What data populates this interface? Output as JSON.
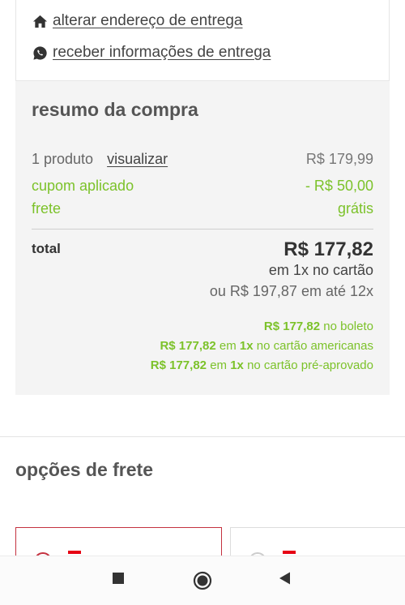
{
  "delivery_links": {
    "change_address": "alterar endereço de entrega",
    "receive_info": "receber informações de entrega"
  },
  "summary": {
    "title": "resumo da compra",
    "products_label": "1 produto",
    "view_link": "visualizar",
    "products_value": "R$ 179,99",
    "coupon_label": "cupom aplicado",
    "coupon_value": "- R$ 50,00",
    "shipping_label": "frete",
    "shipping_value": "grátis",
    "total_label": "total",
    "total_value": "R$ 177,82",
    "total_installment": "em 1x no cartão",
    "alt_installment": "ou R$ 197,87 em até 12x",
    "options": {
      "boleto_value": "R$ 177,82",
      "boleto_text": "no boleto",
      "americanas_value": "R$ 177,82",
      "americanas_mid": "em",
      "americanas_x": "1x",
      "americanas_text": "no cartão americanas",
      "preapproved_value": "R$ 177,82",
      "preapproved_mid": "em",
      "preapproved_x": "1x",
      "preapproved_text": "no cartão pré-aprovado"
    }
  },
  "shipping_options": {
    "title": "opções de frete"
  },
  "colors": {
    "green": "#7cc22a",
    "brand_red": "#e60014",
    "summary_bg": "#f4f4f4"
  },
  "icons": {
    "address": "home-icon",
    "info": "whatsapp-icon",
    "nav_recent": "square-icon",
    "nav_home": "circle-icon",
    "nav_back": "triangle-back-icon"
  }
}
